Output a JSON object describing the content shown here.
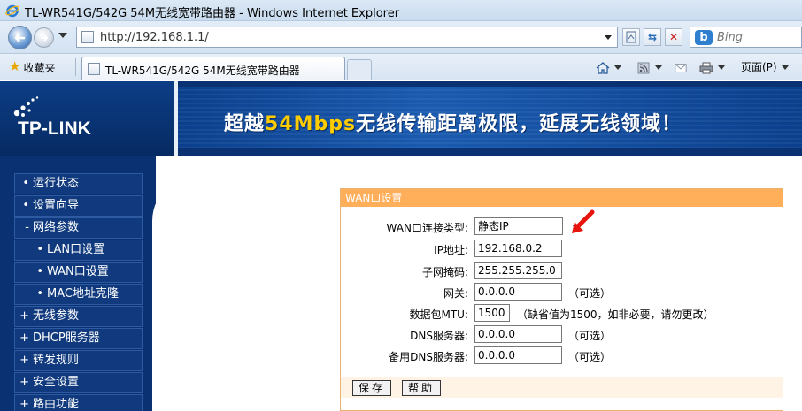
{
  "window": {
    "title": "TL-WR541G/542G 54M无线宽带路由器 - Windows Internet Explorer"
  },
  "address_bar": {
    "url": "http://192.168.1.1/",
    "search_placeholder": "Bing",
    "search_provider_icon": "bing-icon"
  },
  "tabs": {
    "favorites_label": "收藏夹",
    "active_tab_title": "TL-WR541G/542G 54M无线宽带路由器",
    "page_menu_label": "页面(P)"
  },
  "banner": {
    "logo": "TP-LINK",
    "slogan_part1": "超越",
    "slogan_highlight": "54Mbps",
    "slogan_part2": "无线传输距离极限，延展无线领域！"
  },
  "menu": [
    {
      "bullet": "•",
      "label": "运行状态"
    },
    {
      "bullet": "•",
      "label": "设置向导"
    },
    {
      "bullet": "-",
      "label": "网络参数"
    },
    {
      "bullet": "•",
      "label": "LAN口设置"
    },
    {
      "bullet": "•",
      "label": "WAN口设置"
    },
    {
      "bullet": "•",
      "label": "MAC地址克隆"
    },
    {
      "bullet": "+",
      "label": "无线参数"
    },
    {
      "bullet": "+",
      "label": "DHCP服务器"
    },
    {
      "bullet": "+",
      "label": "转发规则"
    },
    {
      "bullet": "+",
      "label": "安全设置"
    },
    {
      "bullet": "+",
      "label": "路由功能"
    }
  ],
  "wan": {
    "title": "WAN口设置",
    "connection_type_label": "WAN口连接类型:",
    "connection_type_value": "静态IP",
    "ip_label": "IP地址:",
    "ip_value": "192.168.0.2",
    "mask_label": "子网掩码:",
    "mask_value": "255.255.255.0",
    "gateway_label": "网关:",
    "gateway_value": "0.0.0.0",
    "gateway_hint": "（可选）",
    "mtu_label": "数据包MTU:",
    "mtu_value": "1500",
    "mtu_hint": "（缺省值为1500，如非必要，请勿更改）",
    "dns_label": "DNS服务器:",
    "dns_value": "0.0.0.0",
    "dns_hint": "（可选）",
    "dns2_label": "备用DNS服务器:",
    "dns2_value": "0.0.0.0",
    "dns2_hint": "（可选）",
    "save_label": "保存",
    "help_label": "帮助"
  },
  "colors": {
    "banner_navy": "#0a3171",
    "panel_header": "#ffae59",
    "panel_border": "#e9b070",
    "annotation_arrow": "#e8150e"
  }
}
